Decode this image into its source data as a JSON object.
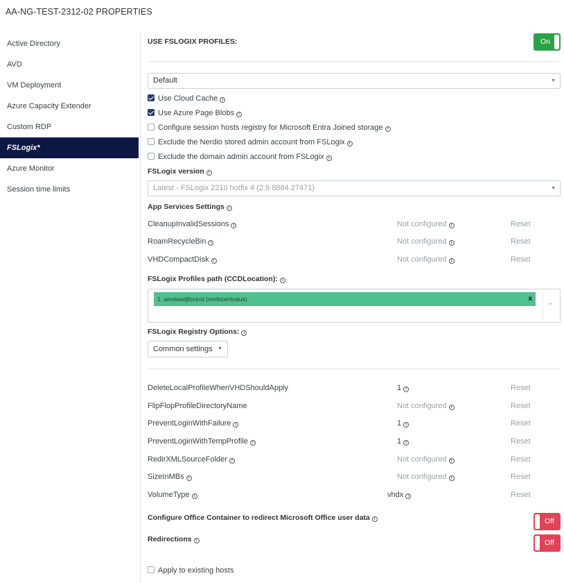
{
  "title": "AA-NG-TEST-2312-02 PROPERTIES",
  "sidebar": {
    "items": [
      {
        "label": "Active Directory"
      },
      {
        "label": "AVD"
      },
      {
        "label": "VM Deployment"
      },
      {
        "label": "Azure Capacity Extender"
      },
      {
        "label": "Custom RDP"
      },
      {
        "label": "FSLogix*"
      },
      {
        "label": "Azure Monitor"
      },
      {
        "label": "Session time limits"
      }
    ],
    "active_index": 5
  },
  "main": {
    "use_fslogix": {
      "label": "USE FSLOGIX PROFILES:",
      "toggle": "On"
    },
    "profile_select": {
      "value": "Default"
    },
    "checkboxes": [
      {
        "label": "Use Cloud Cache",
        "checked": true
      },
      {
        "label": "Use Azure Page Blobs",
        "checked": true
      },
      {
        "label": "Configure session hosts registry for Microsoft Entra Joined storage",
        "checked": false
      },
      {
        "label": "Exclude the Nerdio stored admin account from FSLogix",
        "checked": false
      },
      {
        "label": "Exclude the domain admin account from FSLogix",
        "checked": false
      }
    ],
    "version": {
      "label": "FSLogix version",
      "value": "Latest - FSLogix 2210 hotfix 4 (2.9.8884.27471)"
    },
    "app_services": {
      "label": "App Services Settings",
      "rows": [
        {
          "name": "CleanupInvalidSessions",
          "value": "Not configured",
          "reset": "Reset"
        },
        {
          "name": "RoamRecycleBin",
          "value": "Not configured",
          "reset": "Reset"
        },
        {
          "name": "VHDCompactDisk",
          "value": "Not configured",
          "reset": "Reset"
        }
      ]
    },
    "profiles_path": {
      "label": "FSLogix Profiles path (CCDLocation):",
      "tag": "1. amolaadjfoxtrot (northcentralus)",
      "tag_remove": "x"
    },
    "registry": {
      "label": "FSLogix Registry Options:",
      "select": "Common settings",
      "rows": [
        {
          "name": "DeleteLocalProfileWhenVHDShouldApply",
          "value": "1",
          "reset": "Reset"
        },
        {
          "name": "FlipFlopProfileDirectoryName",
          "value": "Not configured",
          "reset": "Reset"
        },
        {
          "name": "PreventLoginWithFailure",
          "value": "1",
          "reset": "Reset"
        },
        {
          "name": "PreventLoginWithTempProfile",
          "value": "1",
          "reset": "Reset"
        },
        {
          "name": "RedirXMLSourceFolder",
          "value": "Not configured",
          "reset": "Reset"
        },
        {
          "name": "SizeInMBs",
          "value": "Not configured",
          "reset": "Reset"
        },
        {
          "name": "VolumeType",
          "value": "vhdx",
          "reset": "Reset"
        }
      ]
    },
    "office_container": {
      "label": "Configure Office Container to redirect Microsoft Office user data",
      "toggle": "Off"
    },
    "redirections": {
      "label": "Redirections",
      "toggle": "Off"
    },
    "apply_existing": {
      "label": "Apply to existing hosts",
      "checked": false
    }
  },
  "colors": {
    "sidebar_active_bg": "#0d1744",
    "toggle_on": "#2aa346",
    "toggle_off": "#e24258",
    "tag_bg": "#52c08e"
  },
  "icons": [
    "info-icon",
    "caret-down-icon",
    "chevron-down-icon",
    "remove-x-icon",
    "checkbox-check-icon"
  ]
}
